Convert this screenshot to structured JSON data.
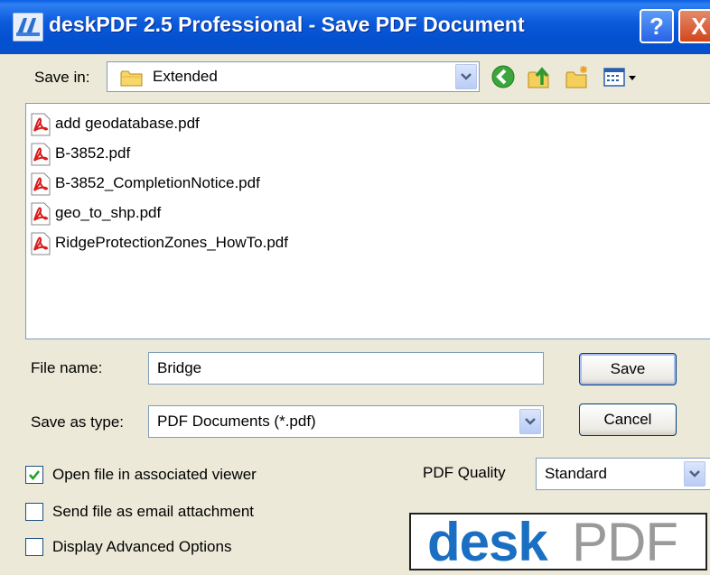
{
  "window": {
    "title": "deskPDF 2.5 Professional - Save PDF Document",
    "help_label": "?",
    "close_label": "X"
  },
  "save_in": {
    "label": "Save in:",
    "value": "Extended"
  },
  "toolbar": {
    "icons": [
      "back-icon",
      "up-folder-icon",
      "new-folder-icon",
      "view-menu-icon"
    ]
  },
  "files": [
    {
      "name": "add geodatabase.pdf"
    },
    {
      "name": "B-3852.pdf"
    },
    {
      "name": "B-3852_CompletionNotice.pdf"
    },
    {
      "name": "geo_to_shp.pdf"
    },
    {
      "name": "RidgeProtectionZones_HowTo.pdf"
    }
  ],
  "file_name": {
    "label": "File name:",
    "value": "Bridge"
  },
  "save_as_type": {
    "label": "Save as type:",
    "value": "PDF Documents (*.pdf)"
  },
  "buttons": {
    "save": "Save",
    "cancel": "Cancel"
  },
  "options": {
    "open_viewer": {
      "label": "Open file in associated viewer",
      "checked": true
    },
    "send_email": {
      "label": "Send file as email attachment",
      "checked": false
    },
    "advanced": {
      "label": "Display Advanced Options",
      "checked": false
    }
  },
  "quality": {
    "label": "PDF Quality",
    "value": "Standard"
  },
  "logo": {
    "desk": "desk",
    "pdf": "PDF"
  },
  "colors": {
    "titlebar": "#0451D1",
    "dialog_bg": "#ECE9D8",
    "logo_blue": "#1B6FC2",
    "logo_gray": "#9A9A9A"
  }
}
